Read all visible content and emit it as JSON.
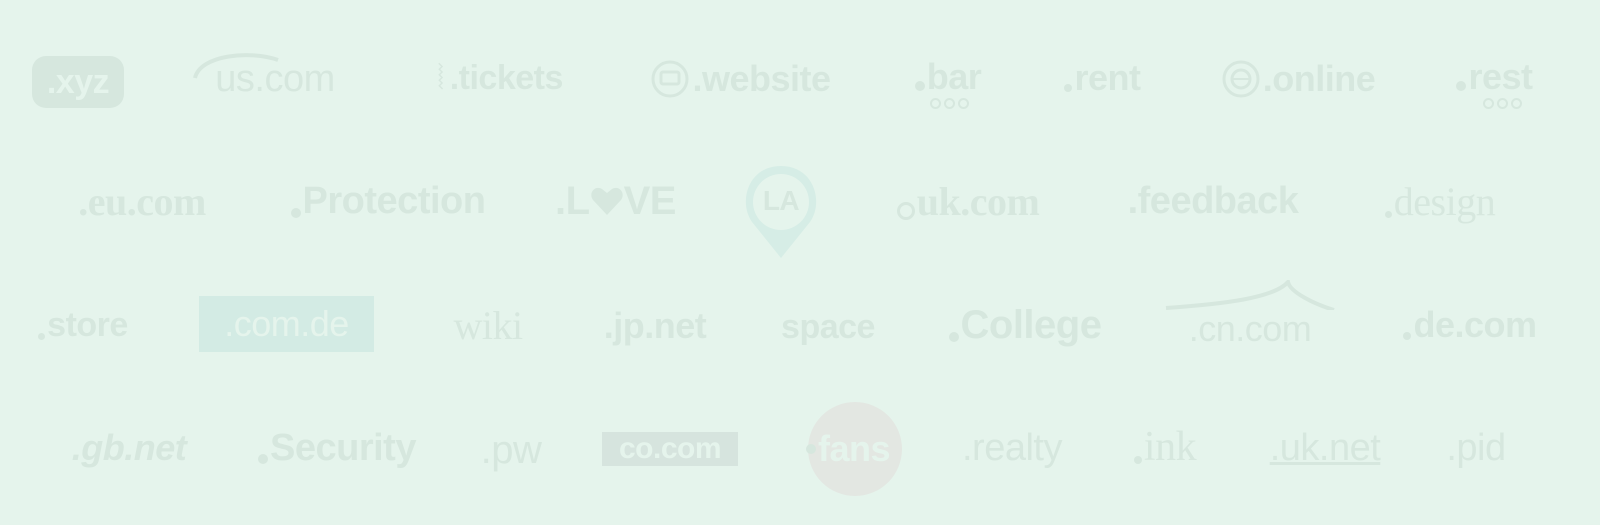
{
  "theme": {
    "background": "#e5f4ec",
    "logo_color": "#d6e7de",
    "com_de_bg": "#d3ebe4",
    "co_com_bg": "#d6e4de",
    "fans_bg": "#e3e7e2"
  },
  "rows": [
    [
      "xyz",
      "us.com",
      "tickets",
      "website",
      "bar",
      "rent",
      "online",
      "rest"
    ],
    [
      "eu.com",
      "Protection",
      "LOVE",
      "LA",
      "uk.com",
      "feedback",
      "design"
    ],
    [
      "store",
      "com.de",
      "wiki",
      "jp.net",
      "space",
      "College",
      "cn.com",
      "de.com"
    ],
    [
      "gb.net",
      "Security",
      "pw",
      "co.com",
      "fans",
      "realty",
      "ink",
      "uk.net",
      "pid"
    ]
  ],
  "labels": {
    "xyz": ".xyz",
    "us_com": "us.com",
    "tickets": ".tickets",
    "website": ".website",
    "bar": "bar",
    "rent": "rent",
    "online": ".online",
    "rest": "rest",
    "eu_com": ".eu.com",
    "protection": "Protection",
    "love_l": ".L",
    "love_ve": "VE",
    "la": "LA",
    "uk_com": "uk.com",
    "feedback": ".feedback",
    "design": "design",
    "store": "store",
    "com_de": ".com.de",
    "wiki": "wiki",
    "jp_net": ".jp.net",
    "space": "space",
    "college": "College",
    "cn_com": ".cn.com",
    "de_com": "de.com",
    "gb_net": ".gb.net",
    "security": "Security",
    "pw": ".pw",
    "co_com": "co.com",
    "fans": "fans",
    "realty": ".realty",
    "ink": "ink",
    "uk_net": ".uk.net",
    "pid": ".pid"
  }
}
